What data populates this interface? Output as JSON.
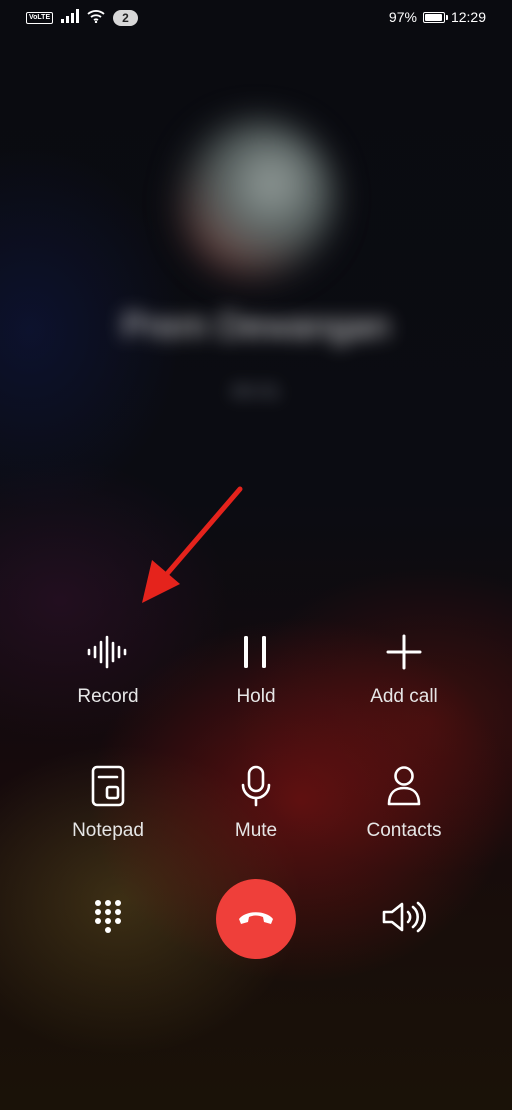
{
  "status_bar": {
    "volte": "VoLTE",
    "notification_count": "2",
    "battery_percent": "97%",
    "battery_level": 0.97,
    "time": "12:29"
  },
  "caller": {
    "name": "Prem Dewangan",
    "subtitle": "00:01"
  },
  "controls": {
    "record": {
      "label": "Record",
      "icon": "waveform-icon"
    },
    "hold": {
      "label": "Hold",
      "icon": "pause-icon"
    },
    "add_call": {
      "label": "Add call",
      "icon": "plus-icon"
    },
    "notepad": {
      "label": "Notepad",
      "icon": "notepad-icon"
    },
    "mute": {
      "label": "Mute",
      "icon": "microphone-icon"
    },
    "contacts": {
      "label": "Contacts",
      "icon": "person-icon"
    }
  },
  "bottom_bar": {
    "dialpad_icon": "dialpad-icon",
    "end_call_icon": "phone-hangup-icon",
    "speaker_icon": "speaker-icon"
  },
  "colors": {
    "end_call": "#ef3f3a",
    "annotation_arrow": "#e5231c",
    "label_text": "#e6e6e6"
  }
}
